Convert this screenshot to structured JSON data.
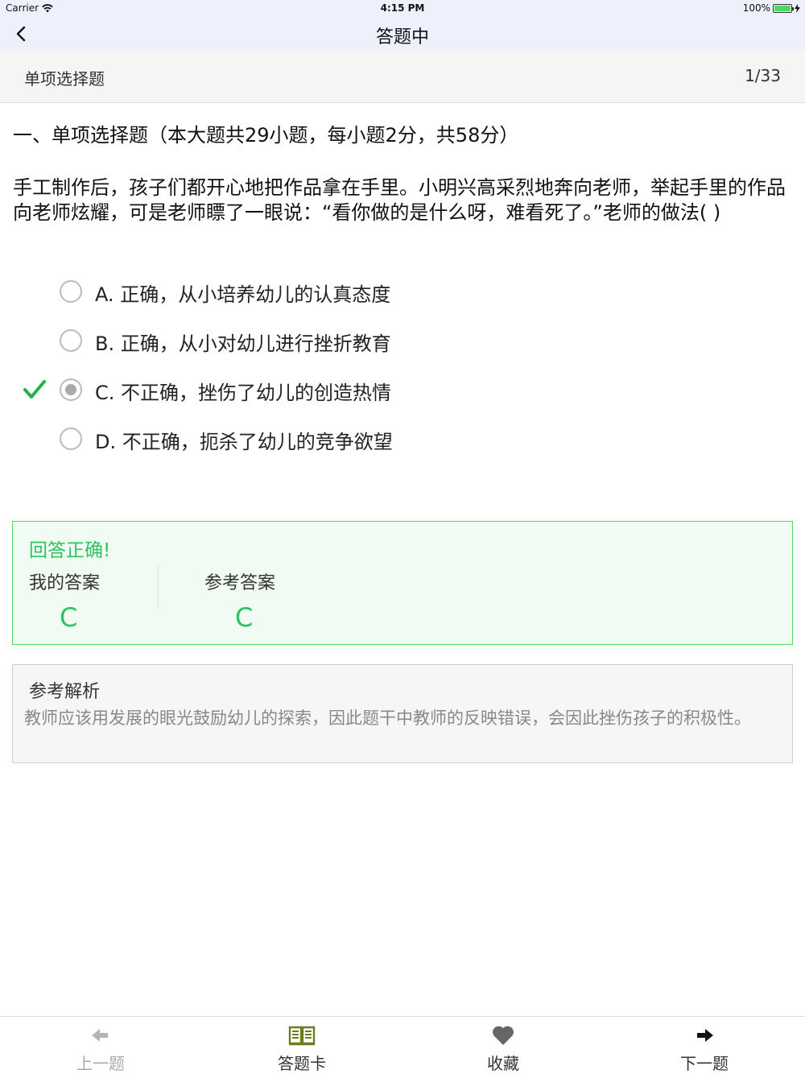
{
  "status_bar": {
    "carrier": "Carrier",
    "time": "4:15 PM",
    "battery": "100%"
  },
  "nav": {
    "title": "答题中",
    "back_icon": "chevron-left-icon"
  },
  "section": {
    "name": "单项选择题",
    "progress": "1/33"
  },
  "question": {
    "heading": "一、单项选择题（本大题共29小题，每小题2分，共58分）",
    "stem": "手工制作后，孩子们都开心地把作品拿在手里。小明兴高采烈地奔向老师，举起手里的作品向老师炫耀，可是老师瞟了一眼说：“看你做的是什么呀，难看死了。”老师的做法(   )",
    "options": [
      {
        "label": "A. 正确，从小培养幼儿的认真态度",
        "selected": false,
        "correct": false
      },
      {
        "label": "B. 正确，从小对幼儿进行挫折教育",
        "selected": false,
        "correct": false
      },
      {
        "label": "C. 不正确，挫伤了幼儿的创造热情",
        "selected": true,
        "correct": true
      },
      {
        "label": "D. 不正确，扼杀了幼儿的竞争欲望",
        "selected": false,
        "correct": false
      }
    ]
  },
  "result": {
    "verdict": "回答正确!",
    "my_answer_label": "我的答案",
    "my_answer": "C",
    "ref_answer_label": "参考答案",
    "ref_answer": "C"
  },
  "analysis": {
    "title": "参考解析",
    "text": "教师应该用发展的眼光鼓励幼儿的探索，因此题干中教师的反映错误，会因此挫伤孩子的积极性。"
  },
  "tabs": [
    {
      "label": "上一题",
      "icon": "arrow-left-icon",
      "enabled": false
    },
    {
      "label": "答题卡",
      "icon": "book-icon",
      "enabled": true
    },
    {
      "label": "收藏",
      "icon": "heart-icon",
      "enabled": true
    },
    {
      "label": "下一题",
      "icon": "arrow-right-icon",
      "enabled": true
    }
  ],
  "colors": {
    "correct_green": "#2ec35c",
    "check_green": "#22b14c",
    "nav_bg": "#eef1fb",
    "book_icon": "#6b7d1c"
  }
}
